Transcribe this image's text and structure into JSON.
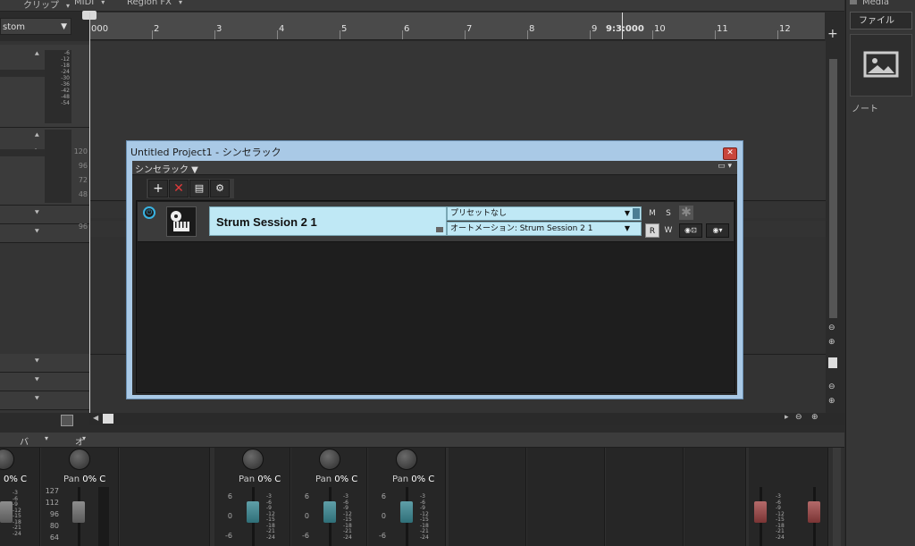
{
  "topbar": {
    "menus": [
      "クリップ",
      "MIDI",
      "Region FX"
    ]
  },
  "track_header": {
    "preset_label": "stom"
  },
  "ruler": {
    "marks": [
      "000",
      "2",
      "3",
      "4",
      "5",
      "6",
      "7",
      "8",
      "9",
      "9:3:000",
      "10",
      "11",
      "12"
    ]
  },
  "lanes": {
    "meter_labels": [
      "-6",
      "-12",
      "-18",
      "-24",
      "-30",
      "-36",
      "-42",
      "-48",
      "-54"
    ],
    "side_values": [
      "120",
      "96",
      "72",
      "48",
      "96"
    ]
  },
  "media_panel": {
    "tab": "Media",
    "file_button": "ファイルの...",
    "note": "ノート"
  },
  "dialog": {
    "title": "Untitled Project1 - シンセラック",
    "close": "✕",
    "rack_menu": "シンセラック ▼",
    "rack_menu_right": "▭ ▾",
    "toolbar": {
      "add": "+",
      "delete": "✕",
      "props": "▤",
      "insert": "⚙"
    },
    "slot": {
      "power": "⏻",
      "name": "Strum Session 2 1",
      "preset": "プリセットなし",
      "automation": "オートメーション: Strum Session 2 1",
      "mute": "M",
      "solo": "S",
      "read": "R",
      "write": "W",
      "freeze": "✱",
      "out1": "◉⊡",
      "out2": "◉▾"
    }
  },
  "mixer": {
    "header": {
      "bus": "バス",
      "options": "オプション"
    },
    "strips": [
      {
        "pan_label": "Pan",
        "pan_value": "0% C"
      },
      {
        "pan_label": "Pan",
        "pan_value": "0% C"
      },
      {
        "pan_label": "Pan",
        "pan_value": "0% C"
      },
      {
        "pan_label": "Pan",
        "pan_value": "0% C"
      },
      {
        "pan_label": "Pan",
        "pan_value": "0% C"
      }
    ],
    "midi_scale": [
      "127",
      "112",
      "96",
      "80",
      "64"
    ],
    "db_scale": [
      "6",
      "0",
      "-6"
    ],
    "meter_scale": [
      "-3",
      "-6",
      "-9",
      "-12",
      "-15",
      "-18",
      "-21",
      "-24"
    ]
  },
  "colors": {
    "accent": "#39b3e2",
    "slot_bg": "#bfe8f5",
    "dialog_frame": "#a9c9e6",
    "close": "#c9463c"
  }
}
